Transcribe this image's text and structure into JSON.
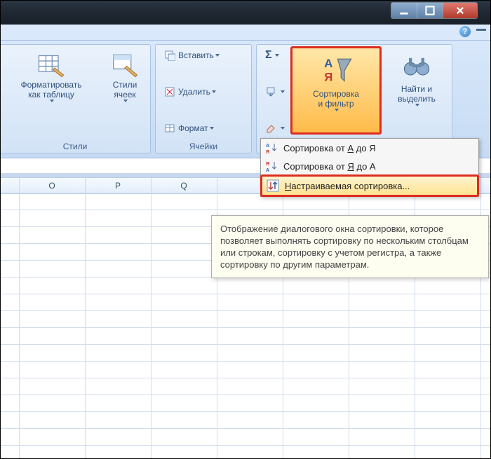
{
  "window": {
    "min_tooltip": "Minimize",
    "max_tooltip": "Maximize",
    "close_tooltip": "Close"
  },
  "ribbon": {
    "help": "?",
    "groups": {
      "styles": {
        "label": "Стили",
        "format_as_table": "Форматировать\nкак таблицу",
        "cell_styles": "Стили\nячеек"
      },
      "cells": {
        "label": "Ячейки",
        "insert": "Вставить",
        "delete": "Удалить",
        "format": "Формат"
      },
      "editing": {
        "sigma": "Σ",
        "fill_icon": "fill",
        "clear_icon": "clear",
        "sort_filter": "Сортировка\nи фильтр",
        "find_select": "Найти и\nвыделить"
      }
    }
  },
  "sort_menu": {
    "items": [
      {
        "label_prefix": "Сортировка от ",
        "ul": "А",
        "label_suffix": " до Я",
        "icon": "a-z"
      },
      {
        "label_prefix": "Сортировка от ",
        "ul": "Я",
        "label_suffix": " до А",
        "icon": "z-a"
      },
      {
        "label_prefix": "",
        "ul": "Н",
        "label_suffix": "астраиваемая сортировка...",
        "icon": "custom",
        "highlight": true
      }
    ]
  },
  "tooltip": {
    "text": "Отображение диалогового окна сортировки, которое позволяет выполнять сортировку по нескольким столбцам или строкам, сортировку с учетом регистра, а также сортировку по другим параметрам."
  },
  "sheet": {
    "columns": [
      "O",
      "P",
      "Q"
    ]
  }
}
